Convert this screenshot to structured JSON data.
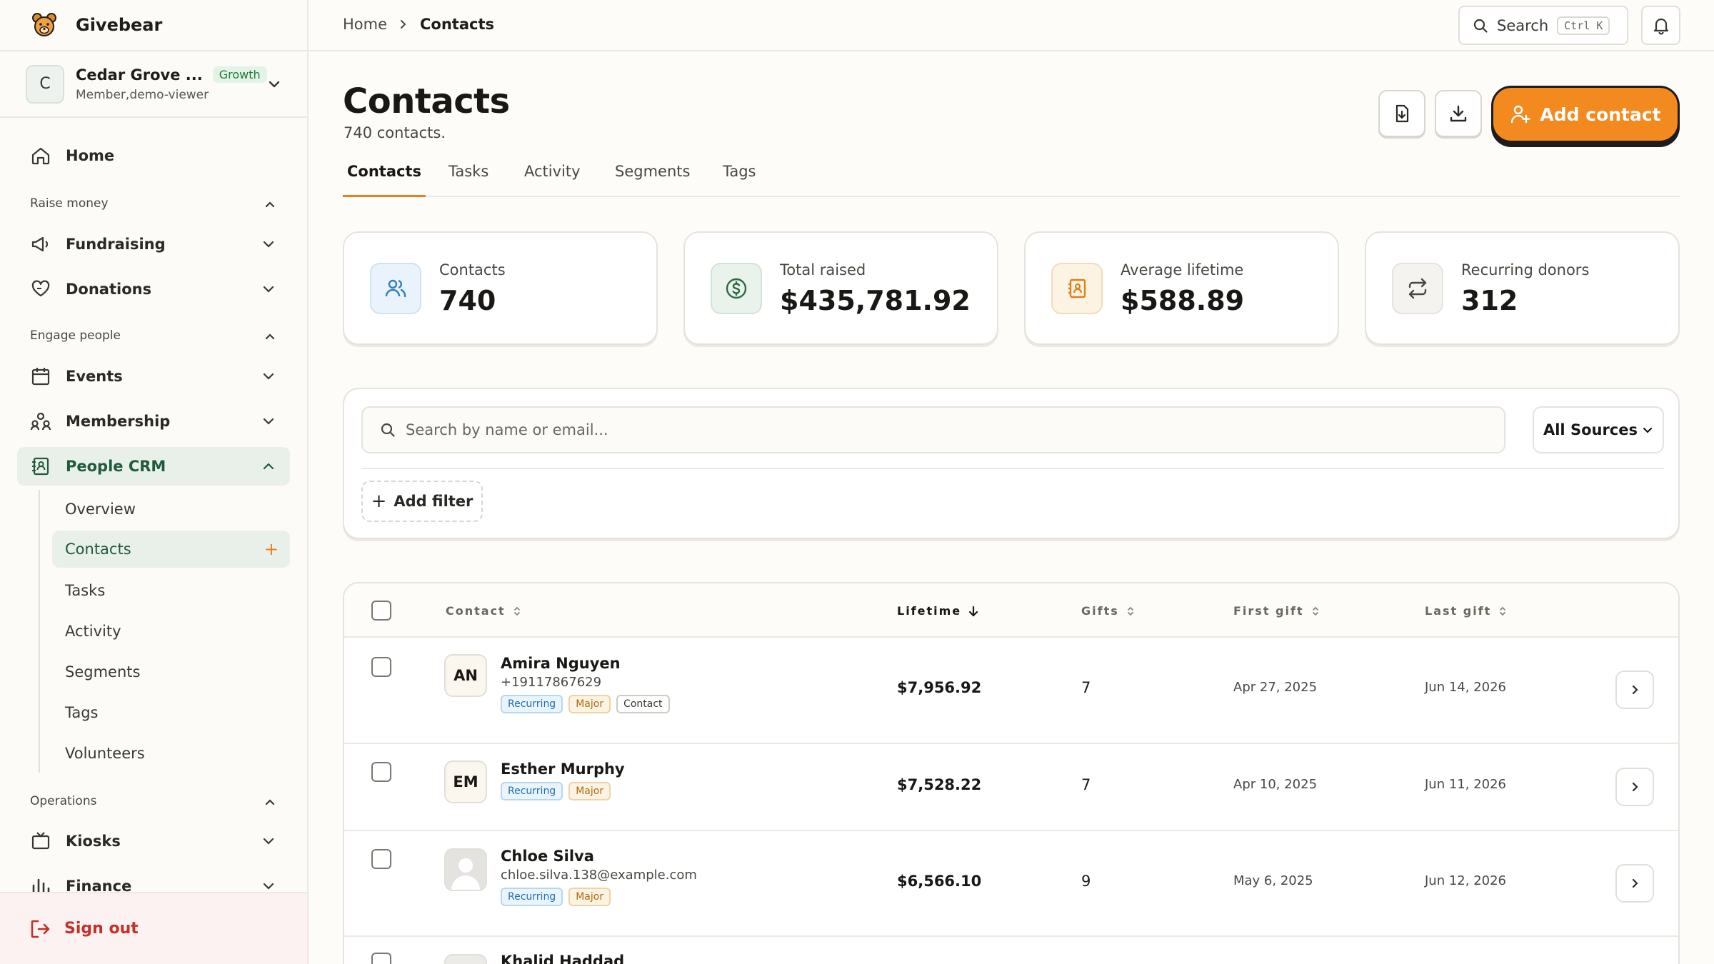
{
  "app": {
    "name": "Givebear"
  },
  "org": {
    "name": "Cedar Grove ...",
    "plan": "Growth",
    "role": "Member,demo-viewer",
    "avatar_initial": "C"
  },
  "nav": {
    "home": "Home",
    "sections": [
      {
        "label": "Raise money",
        "items": [
          "Fundraising",
          "Donations"
        ]
      },
      {
        "label": "Engage people",
        "items": [
          "Events",
          "Membership",
          "People CRM"
        ]
      },
      {
        "label": "Operations",
        "items": [
          "Kiosks",
          "Finance"
        ]
      }
    ],
    "people_crm_sub": [
      "Overview",
      "Contacts",
      "Tasks",
      "Activity",
      "Segments",
      "Tags",
      "Volunteers"
    ],
    "sign_out": "Sign out"
  },
  "topbar": {
    "breadcrumb": [
      "Home",
      "Contacts"
    ],
    "search_label": "Search",
    "search_shortcut": "Ctrl K"
  },
  "page": {
    "title": "Contacts",
    "subtitle": "740 contacts.",
    "add_contact_label": "Add contact",
    "tabs": [
      "Contacts",
      "Tasks",
      "Activity",
      "Segments",
      "Tags"
    ],
    "active_tab": "Contacts"
  },
  "stats": [
    {
      "label": "Contacts",
      "value": "740",
      "icon": "people-icon",
      "color": "#2f7fc1"
    },
    {
      "label": "Total raised",
      "value": "$435,781.92",
      "icon": "dollar-circle-icon",
      "color": "#2a6b45"
    },
    {
      "label": "Average lifetime",
      "value": "$588.89",
      "icon": "address-book-icon",
      "color": "#d9821c"
    },
    {
      "label": "Recurring donors",
      "value": "312",
      "icon": "repeat-icon",
      "color": "#4a4741"
    }
  ],
  "filters": {
    "search_placeholder": "Search by name or email...",
    "source_select": "All Sources",
    "add_filter_label": "Add filter"
  },
  "table": {
    "columns": [
      "Contact",
      "Lifetime",
      "Gifts",
      "First gift",
      "Last gift"
    ],
    "sorted_column": "Lifetime",
    "rows": [
      {
        "initials": "AN",
        "name": "Amira Nguyen",
        "sub": "+19117867629",
        "tags": [
          "Recurring",
          "Major",
          "Contact"
        ],
        "lifetime": "$7,956.92",
        "gifts": "7",
        "first_gift": "Apr 27, 2025",
        "last_gift": "Jun 14, 2026"
      },
      {
        "initials": "EM",
        "name": "Esther Murphy",
        "sub": "",
        "tags": [
          "Recurring",
          "Major"
        ],
        "lifetime": "$7,528.22",
        "gifts": "7",
        "first_gift": "Apr 10, 2025",
        "last_gift": "Jun 11, 2026"
      },
      {
        "initials": "",
        "name": "Chloe Silva",
        "sub": "chloe.silva.138@example.com",
        "tags": [
          "Recurring",
          "Major"
        ],
        "lifetime": "$6,566.10",
        "gifts": "9",
        "first_gift": "May 6, 2025",
        "last_gift": "Jun 12, 2026"
      },
      {
        "initials": "",
        "name": "Khalid Haddad",
        "sub": "",
        "tags": [],
        "lifetime": "",
        "gifts": "",
        "first_gift": "",
        "last_gift": ""
      }
    ]
  },
  "colors": {
    "accent": "#f28a1f",
    "active_nav_bg": "#e9efe9",
    "danger": "#c0322b"
  }
}
